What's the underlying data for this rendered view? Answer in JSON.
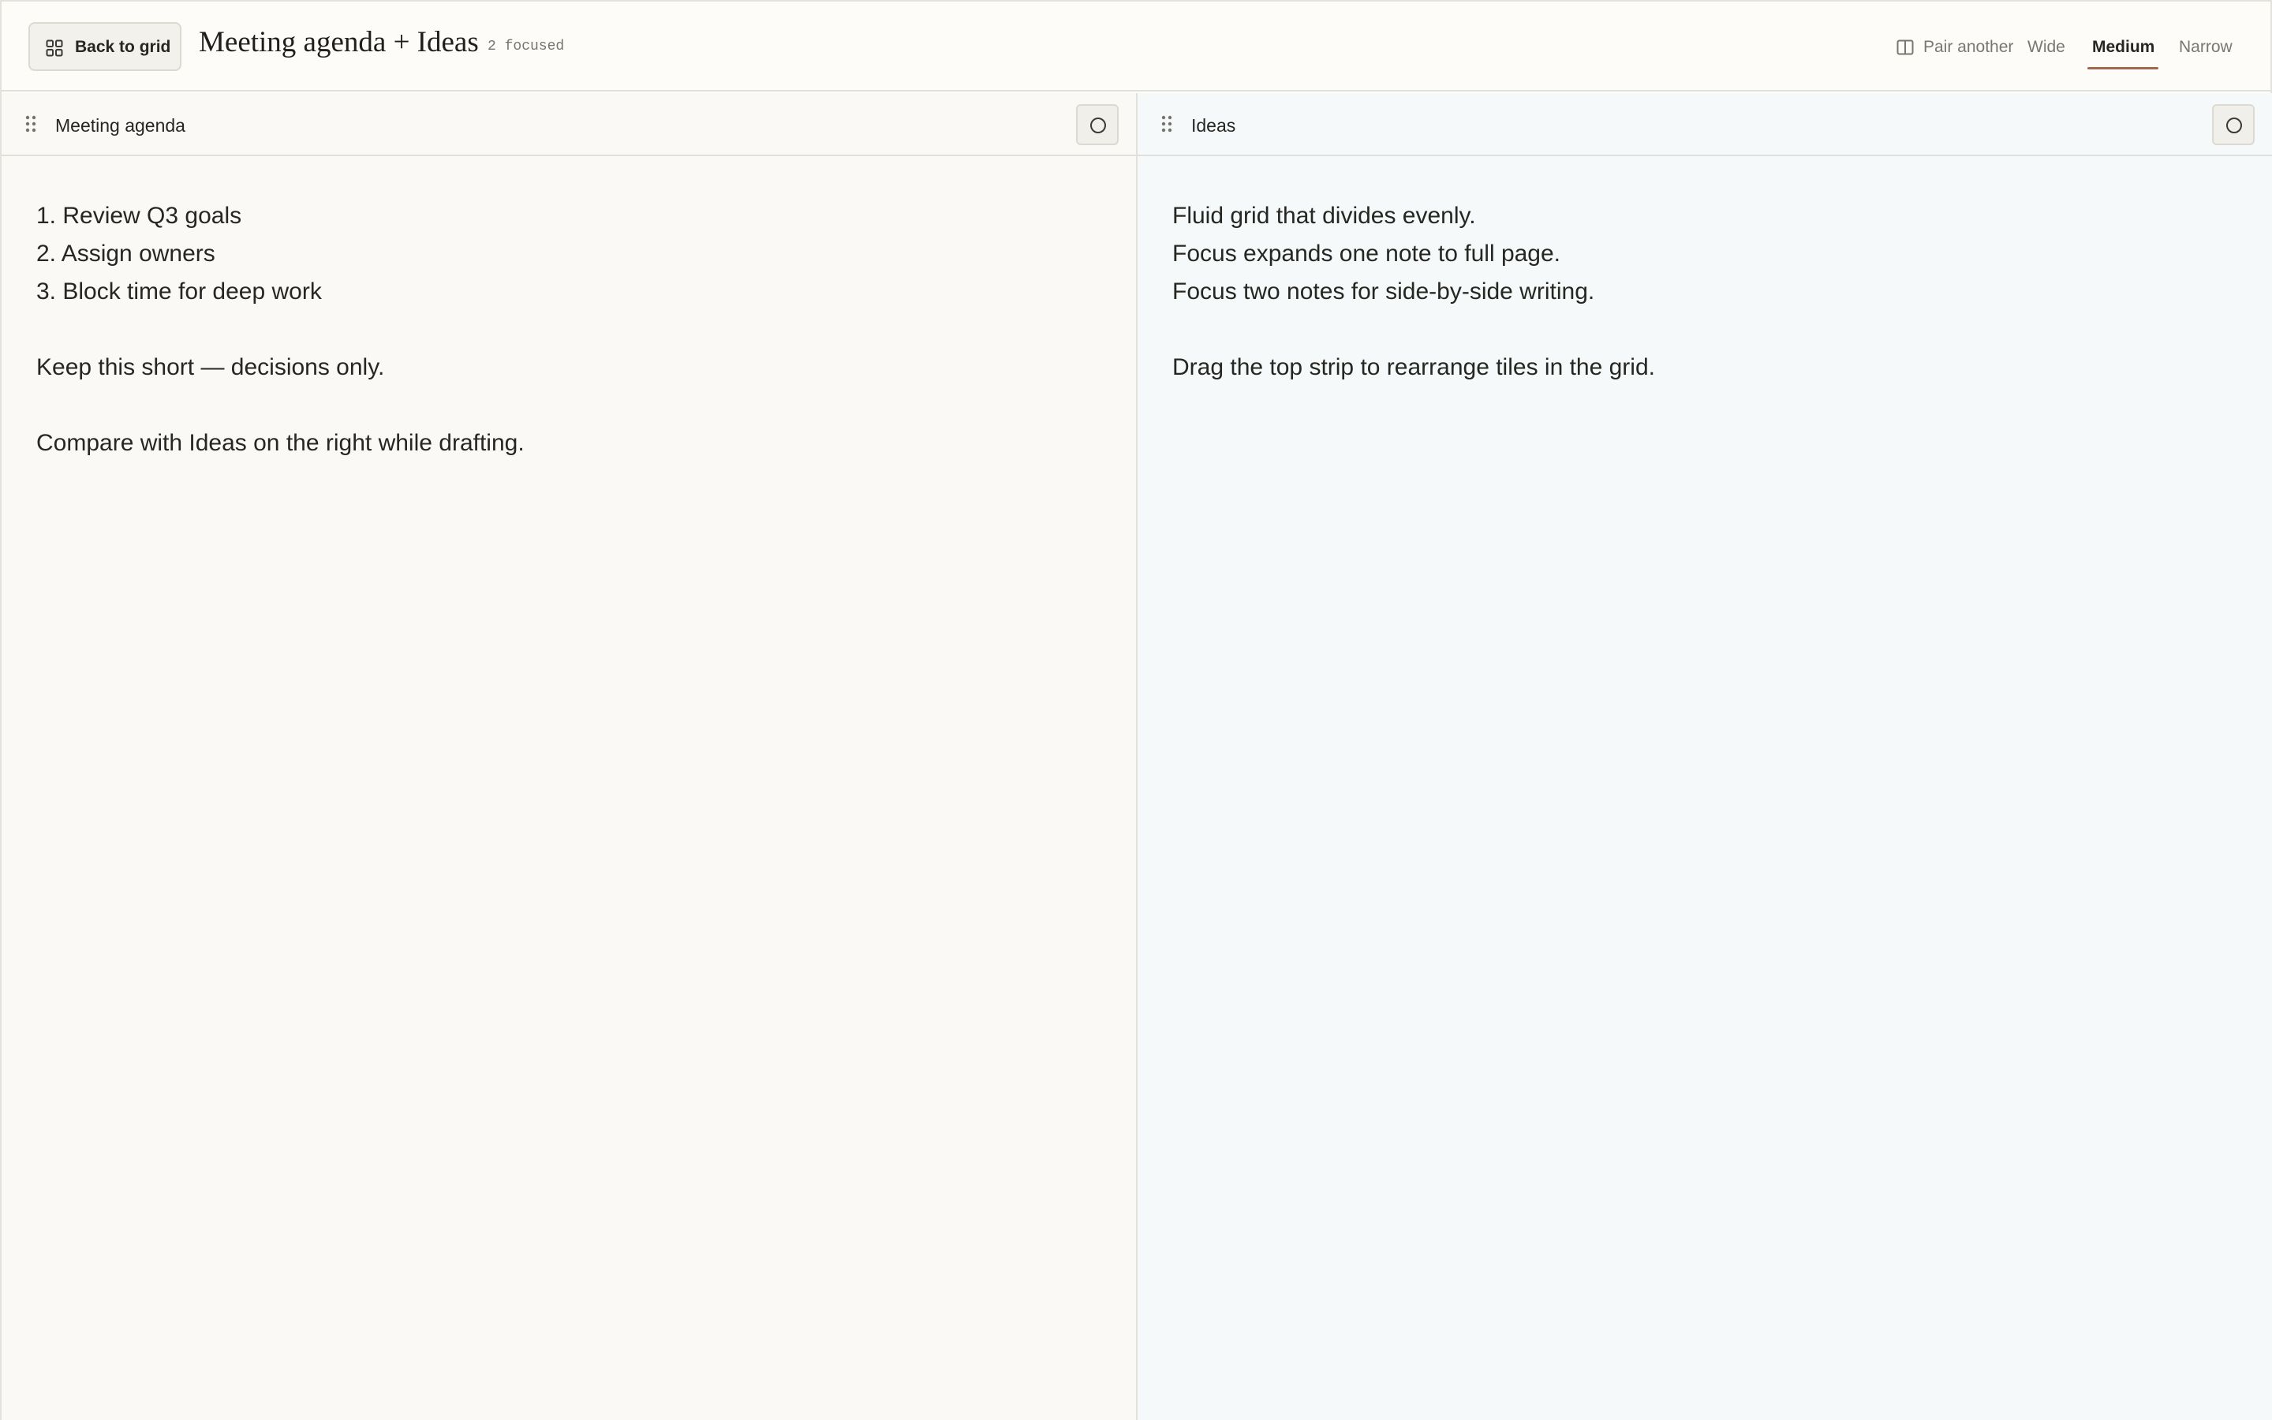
{
  "toolbar": {
    "back_label": "Back to grid",
    "title": "Meeting agenda + Ideas",
    "focus_count": "2 focused",
    "pair_label": "Pair another",
    "widths": [
      "Wide",
      "Medium",
      "Narrow"
    ],
    "active_width": "Medium",
    "accent_color": "#a0674c"
  },
  "panes": [
    {
      "title": "Meeting agenda",
      "background": "#faf9f6",
      "lines": [
        "1. Review Q3 goals",
        "2. Assign owners",
        "3. Block time for deep work",
        "",
        "Keep this short — decisions only.",
        "",
        "Compare with Ideas on the right while drafting."
      ]
    },
    {
      "title": "Ideas",
      "background": "#f6f9f9",
      "lines": [
        "Fluid grid that divides evenly.",
        "Focus expands one note to full page.",
        "Focus two notes for side-by-side writing.",
        "",
        "Drag the top strip to rearrange tiles in the grid."
      ]
    }
  ]
}
